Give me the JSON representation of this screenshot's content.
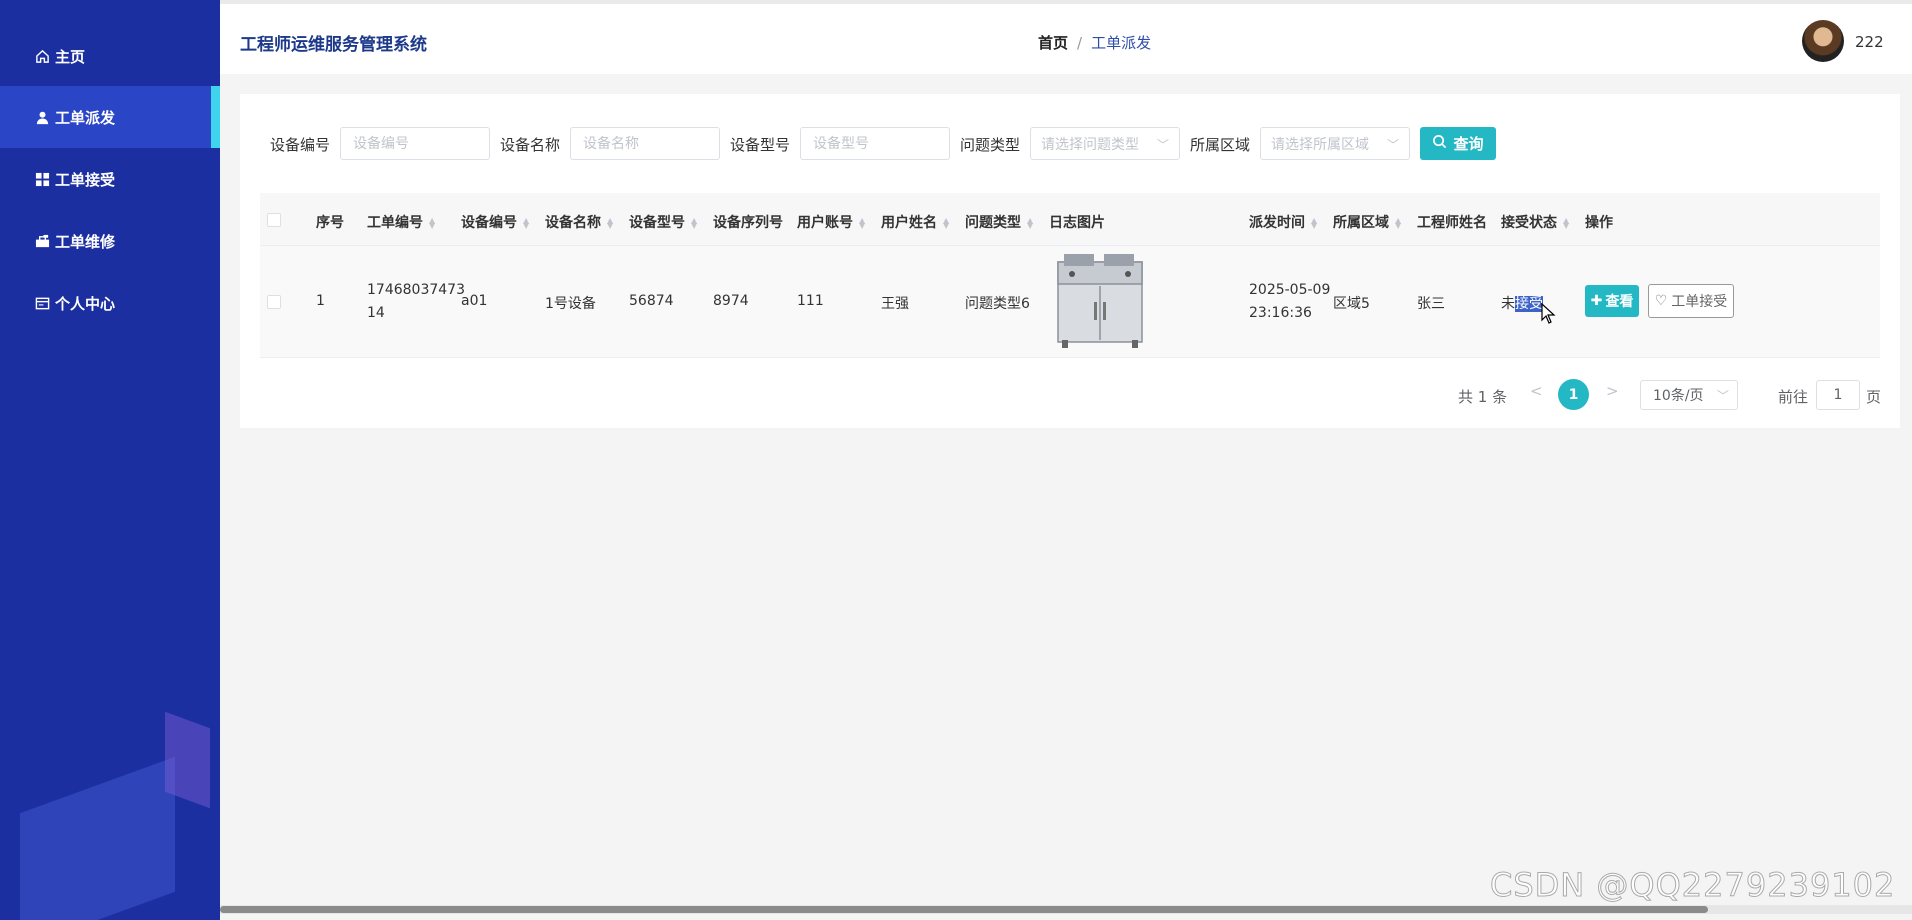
{
  "sidebar": {
    "items": [
      {
        "label": "主页",
        "icon": "home-icon"
      },
      {
        "label": "工单派发",
        "icon": "user-icon"
      },
      {
        "label": "工单接受",
        "icon": "grid-icon"
      },
      {
        "label": "工单维修",
        "icon": "briefcase-icon"
      },
      {
        "label": "个人中心",
        "icon": "id-card-icon"
      }
    ],
    "active_index": 1
  },
  "header": {
    "title": "工程师运维服务管理系统",
    "breadcrumb": {
      "home": "首页",
      "separator": "/",
      "current": "工单派发"
    },
    "username": "222"
  },
  "search": {
    "device_no": {
      "label": "设备编号",
      "placeholder": "设备编号"
    },
    "device_name": {
      "label": "设备名称",
      "placeholder": "设备名称"
    },
    "device_model": {
      "label": "设备型号",
      "placeholder": "设备型号"
    },
    "issue_type": {
      "label": "问题类型",
      "placeholder": "请选择问题类型"
    },
    "region": {
      "label": "所属区域",
      "placeholder": "请选择所属区域"
    },
    "query_button": "查询"
  },
  "table": {
    "headers": [
      "序号",
      "工单编号",
      "设备编号",
      "设备名称",
      "设备型号",
      "设备序列号",
      "用户账号",
      "用户姓名",
      "问题类型",
      "日志图片",
      "派发时间",
      "所属区域",
      "工程师姓名",
      "接受状态",
      "操作"
    ],
    "rows": [
      {
        "index": "1",
        "order_no_line1": "17468037473",
        "order_no_line2": "14",
        "device_no": "a01",
        "device_name": "1号设备",
        "device_model": "56874",
        "serial_no": "8974",
        "user_account": "111",
        "user_name": "王强",
        "issue_type": "问题类型6",
        "image_icon": "cabinet-image",
        "dispatch_date": "2025-05-09",
        "dispatch_time": "23:16:36",
        "region": "区域5",
        "engineer": "张三",
        "status_prefix": "未",
        "status_highlight": "接受",
        "view_button": "查看",
        "accept_button": "工单接受"
      }
    ]
  },
  "pagination": {
    "total": "共 1 条",
    "current_page": "1",
    "page_size": "10条/页",
    "goto_label": "前往",
    "goto_value": "1",
    "goto_suffix": "页"
  },
  "watermark": "CSDN @QQ2279239102",
  "colors": {
    "sidebar": "#1c2fa1",
    "sidebar_active": "#2a45c6",
    "accent": "#23b8c4",
    "title": "#1d3a8a"
  }
}
